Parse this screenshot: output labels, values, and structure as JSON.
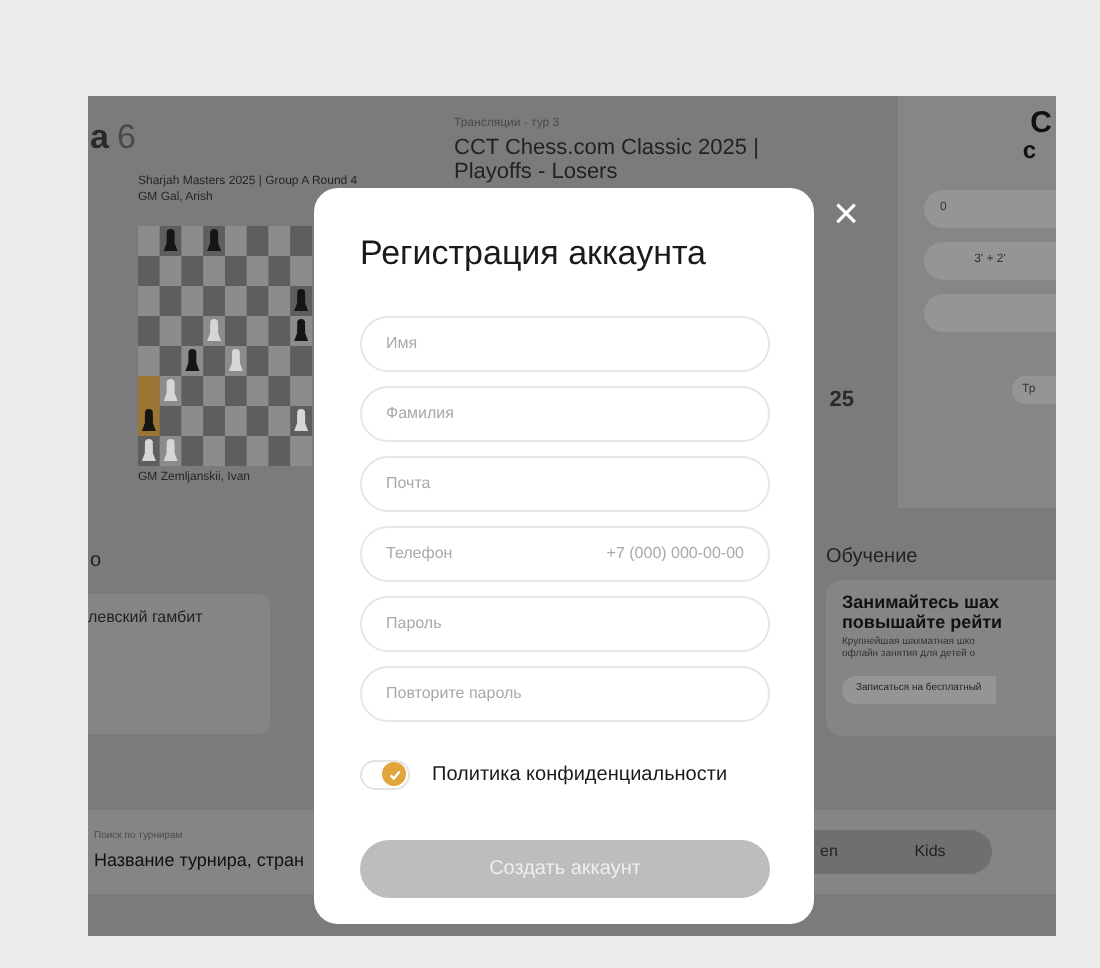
{
  "background": {
    "heading": {
      "text": "а",
      "count": "6"
    },
    "game": {
      "event": "Sharjah Masters 2025 | Group A Round 4",
      "top_player": "GM Gal, Arish",
      "bottom_player": "GM Zemljanskii, Ivan"
    },
    "broadcast": {
      "label": "Трансляции · тур 3",
      "title": "CCT Chess.com Classic 2025 | Playoffs - Losers",
      "year_fragment": "25"
    },
    "side_panel": {
      "title_lines": [
        "С",
        "с"
      ],
      "pills": [
        "0",
        "3' + 2'"
      ],
      "tag": "Тр"
    },
    "openings": {
      "header": "о",
      "card_text": "левский гамбит"
    },
    "learning": {
      "header": "Обучение",
      "title": "Занимайтесь шах\nповышайте рейти",
      "text": "Крупнейшая шахматная шко\nофлайн занятия для детей о",
      "button": "Записаться на бесплатный"
    },
    "search": {
      "label": "Поиск по турнирам",
      "placeholder": "Название турнира, стран",
      "tabs": [
        {
          "label": "en",
          "selected": false
        },
        {
          "label": "Kids",
          "selected": false
        }
      ]
    }
  },
  "modal": {
    "title": "Регистрация аккаунта",
    "fields": [
      {
        "kind": "text",
        "placeholder": "Имя"
      },
      {
        "kind": "text",
        "placeholder": "Фамилия"
      },
      {
        "kind": "text",
        "placeholder": "Почта"
      },
      {
        "kind": "phone",
        "placeholder": "Телефон",
        "mask": "+7 (000) 000-00-00"
      },
      {
        "kind": "password",
        "placeholder": "Пароль"
      },
      {
        "kind": "password",
        "placeholder": "Повторите пароль"
      }
    ],
    "privacy": {
      "label": "Политика конфиденциальности",
      "checked": true
    },
    "submit": {
      "label": "Создать аккаунт",
      "disabled": true
    },
    "close": "×"
  }
}
